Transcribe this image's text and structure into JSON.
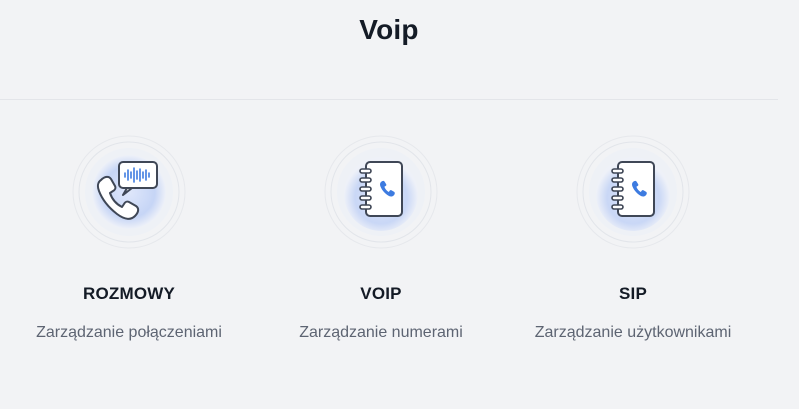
{
  "page": {
    "title": "Voip"
  },
  "cards": [
    {
      "label": "ROZMOWY",
      "description": "Zarządzanie połączeniami",
      "icon": "phone-chat-icon"
    },
    {
      "label": "VOIP",
      "description": "Zarządzanie numerami",
      "icon": "phonebook-icon"
    },
    {
      "label": "SIP",
      "description": "Zarządzanie użytkownikami",
      "icon": "phonebook-icon"
    }
  ],
  "colors": {
    "background": "#f2f3f5",
    "accent": "#3d7be0",
    "text": "#141b26",
    "muted": "#5d6472"
  }
}
